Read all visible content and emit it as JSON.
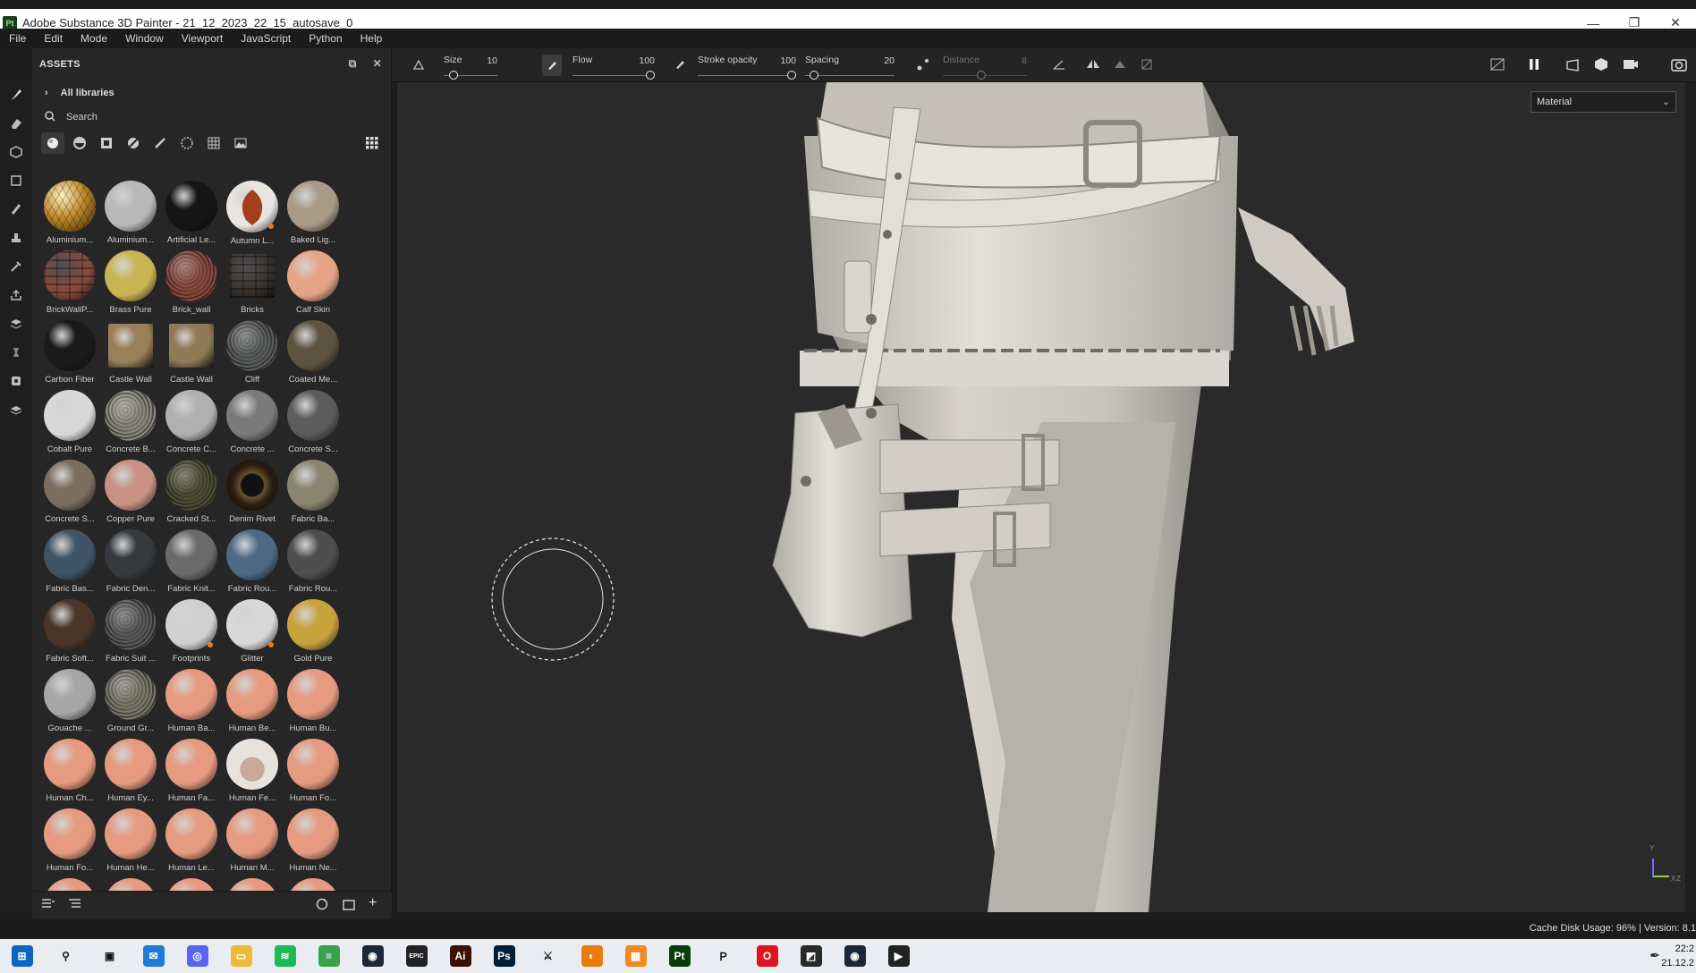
{
  "window": {
    "title": "Adobe Substance 3D Painter - 21_12_2023_22_15_autosave_0",
    "app_icon": "Pt"
  },
  "menu": [
    "File",
    "Edit",
    "Mode",
    "Window",
    "Viewport",
    "JavaScript",
    "Python",
    "Help"
  ],
  "assets": {
    "title": "ASSETS",
    "library": "All libraries",
    "search_placeholder": "Search",
    "materials": [
      {
        "name": "Aluminium...",
        "color": "#c08a2a",
        "texture": "hex"
      },
      {
        "name": "Aluminium...",
        "color": "#b8b8b8"
      },
      {
        "name": "Artificial Le...",
        "color": "#151515"
      },
      {
        "name": "Autumn L...",
        "color": "#e8e4e0",
        "leaf": true,
        "dot": true
      },
      {
        "name": "Baked Lig...",
        "color": "#a89a86"
      },
      {
        "name": "BrickWallP...",
        "color": "#8a4a3a",
        "texture": "brick"
      },
      {
        "name": "Brass Pure",
        "color": "#c9b453"
      },
      {
        "name": "Brick_wall",
        "color": "#8b4a42",
        "texture": "noise"
      },
      {
        "name": "Bricks",
        "color": "#3c3530",
        "texture": "brick2",
        "square": true
      },
      {
        "name": "Calf Skin",
        "color": "#e6a487"
      },
      {
        "name": "Carbon Fiber",
        "color": "#1a1a1a"
      },
      {
        "name": "Castle Wall",
        "color": "#9a8058",
        "square": true
      },
      {
        "name": "Castle Wall",
        "color": "#8f7a56",
        "square": true
      },
      {
        "name": "Cliff",
        "color": "#5a5d5c",
        "texture": "noise"
      },
      {
        "name": "Coated Me...",
        "color": "#5e5240"
      },
      {
        "name": "Cobalt Pure",
        "color": "#d8d8d8"
      },
      {
        "name": "Concrete B...",
        "color": "#8a887e",
        "texture": "noise"
      },
      {
        "name": "Concrete C...",
        "color": "#b0b0b0"
      },
      {
        "name": "Concrete ...",
        "color": "#7a7a7a"
      },
      {
        "name": "Concrete S...",
        "color": "#5c5c5c"
      },
      {
        "name": "Concrete S...",
        "color": "#7b6e5f"
      },
      {
        "name": "Copper Pure",
        "color": "#c89182"
      },
      {
        "name": "Cracked St...",
        "color": "#4e4e36",
        "texture": "noise"
      },
      {
        "name": "Denim Rivet",
        "color": "#3a2a1c",
        "rivet": true
      },
      {
        "name": "Fabric Ba...",
        "color": "#8a8470"
      },
      {
        "name": "Fabric Bas...",
        "color": "#3f5566"
      },
      {
        "name": "Fabric Den...",
        "color": "#363a3e"
      },
      {
        "name": "Fabric Knit...",
        "color": "#6a6a6a"
      },
      {
        "name": "Fabric Rou...",
        "color": "#4c6a86"
      },
      {
        "name": "Fabric Rou...",
        "color": "#4e4e4e"
      },
      {
        "name": "Fabric Soft...",
        "color": "#4a3628"
      },
      {
        "name": "Fabric Suit ...",
        "color": "#5a5a5a",
        "texture": "noise"
      },
      {
        "name": "Footprints",
        "color": "#d0d0d0",
        "dot": true
      },
      {
        "name": "Glitter",
        "color": "#d8d8d8",
        "dot": true
      },
      {
        "name": "Gold Pure",
        "color": "#c8a23a"
      },
      {
        "name": "Gouache ...",
        "color": "#a6a6a6"
      },
      {
        "name": "Ground Gr...",
        "color": "#7a7868",
        "texture": "noise"
      },
      {
        "name": "Human Ba...",
        "color": "#e69a80"
      },
      {
        "name": "Human Be...",
        "color": "#e69a80"
      },
      {
        "name": "Human Bu...",
        "color": "#e69a80"
      },
      {
        "name": "Human Ch...",
        "color": "#e69a80"
      },
      {
        "name": "Human Ey...",
        "color": "#e69a80"
      },
      {
        "name": "Human Fa...",
        "color": "#e69a80"
      },
      {
        "name": "Human Fe...",
        "color": "#d9c8c0",
        "face": true
      },
      {
        "name": "Human Fo...",
        "color": "#e69a80"
      },
      {
        "name": "Human Fo...",
        "color": "#e69a80"
      },
      {
        "name": "Human He...",
        "color": "#e69a80"
      },
      {
        "name": "Human Le...",
        "color": "#e69a80"
      },
      {
        "name": "Human M...",
        "color": "#e69a80"
      },
      {
        "name": "Human Ne...",
        "color": "#e69a80"
      },
      {
        "name": "",
        "color": "#e69a80"
      },
      {
        "name": "",
        "color": "#e69a80"
      },
      {
        "name": "",
        "color": "#e69a80"
      },
      {
        "name": "",
        "color": "#e69a80"
      },
      {
        "name": "",
        "color": "#e69a80"
      }
    ]
  },
  "toolbar": {
    "size_label": "Size",
    "size_value": "10",
    "size_pct": 0.12,
    "flow_label": "Flow",
    "flow_value": "100",
    "flow_pct": 1.0,
    "opacity_label": "Stroke opacity",
    "opacity_value": "100",
    "opacity_pct": 1.0,
    "spacing_label": "Spacing",
    "spacing_value": "20",
    "spacing_pct": 0.05,
    "distance_label": "Distance",
    "distance_value": "8",
    "distance_pct": 0.45
  },
  "viewport": {
    "channel_select": "Material",
    "axis_labels": [
      "Y",
      "X",
      "Z"
    ]
  },
  "status": {
    "text": "Cache Disk Usage:   96% | Version: 8.1"
  },
  "taskbar": {
    "apps": [
      {
        "name": "start",
        "color": "#0a66c2",
        "glyph": "⊞"
      },
      {
        "name": "search",
        "color": "#e9edf1",
        "glyph": "⚲"
      },
      {
        "name": "task-view",
        "color": "#e9edf1",
        "glyph": "▣"
      },
      {
        "name": "mail",
        "color": "#1e7ad6",
        "glyph": "✉"
      },
      {
        "name": "discord",
        "color": "#5865f2",
        "glyph": "◎"
      },
      {
        "name": "explorer",
        "color": "#f1b93a",
        "glyph": "▭"
      },
      {
        "name": "spotify",
        "color": "#1db954",
        "glyph": "≋"
      },
      {
        "name": "layers",
        "color": "#37a24a",
        "glyph": "≡"
      },
      {
        "name": "steam",
        "color": "#1b2838",
        "glyph": "◉"
      },
      {
        "name": "epic",
        "color": "#222",
        "glyph": "EPIC"
      },
      {
        "name": "illustrator",
        "color": "#3a1400",
        "glyph": "Ai"
      },
      {
        "name": "photoshop",
        "color": "#001e36",
        "glyph": "Ps"
      },
      {
        "name": "zbrush",
        "color": "#e9edf1",
        "glyph": "⚔"
      },
      {
        "name": "blender",
        "color": "#e87d0d",
        "glyph": "◐"
      },
      {
        "name": "box",
        "color": "#f08a24",
        "glyph": "▦"
      },
      {
        "name": "painter",
        "color": "#0b3d0b",
        "glyph": "Pt"
      },
      {
        "name": "search2",
        "color": "#e9edf1",
        "glyph": "Ｐ"
      },
      {
        "name": "opera",
        "color": "#e1141e",
        "glyph": "O"
      },
      {
        "name": "sticky",
        "color": "#2a2a2a",
        "glyph": "◩"
      },
      {
        "name": "steam2",
        "color": "#1b2838",
        "glyph": "◉"
      },
      {
        "name": "media",
        "color": "#222",
        "glyph": "▶"
      }
    ],
    "clock_time": "22:2",
    "clock_date": "21.12.2"
  }
}
